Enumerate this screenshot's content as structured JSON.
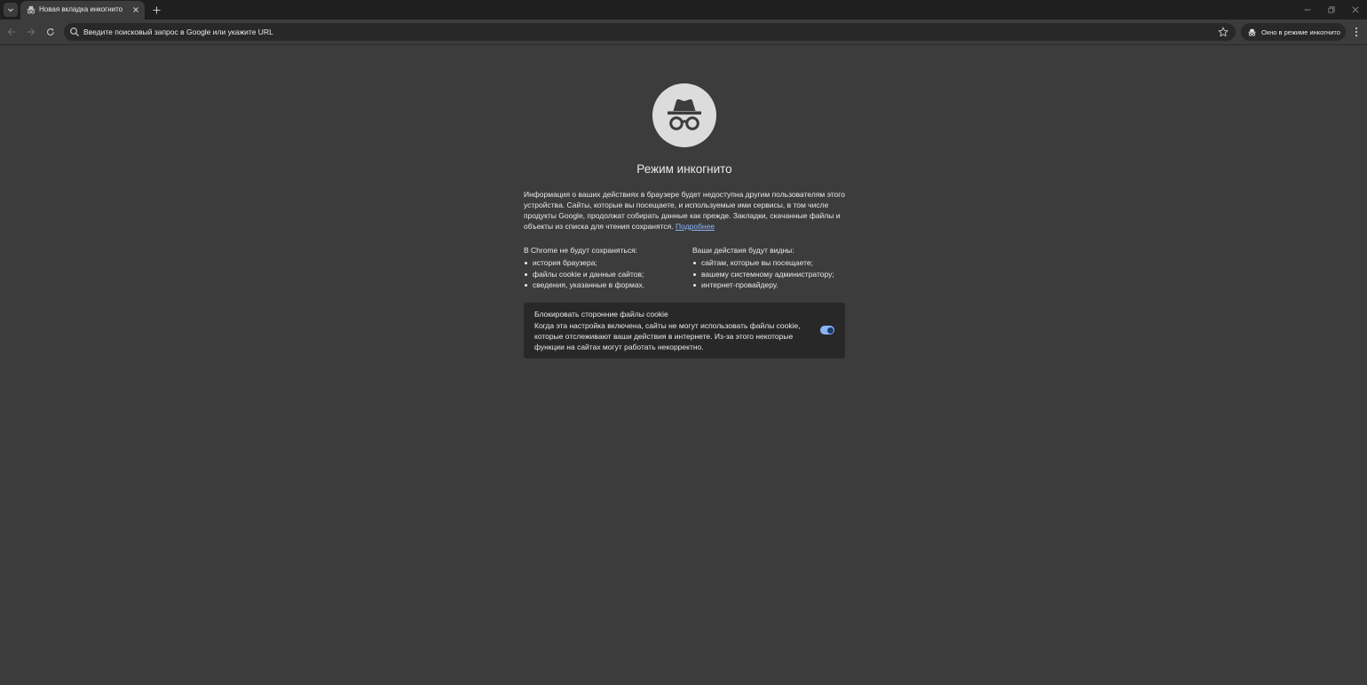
{
  "tab": {
    "title": "Новая вкладка инкогнито",
    "icon": "incognito-icon"
  },
  "toolbar": {
    "omnibox_placeholder": "Введите поисковый запрос в Google или укажите URL",
    "incognito_chip_label": "Окно в режиме инкогнито"
  },
  "page": {
    "title": "Режим инкогнито",
    "intro": "Информация о ваших действиях в браузере будет недоступна другим пользователям этого устройства. Сайты, которые вы посещаете, и используемые ими сервисы, в том числе продукты Google, продолжат собирать данные как прежде. Закладки, скачанные файлы и объекты из списка для чтения сохранятся.",
    "learn_more": "Подробнее",
    "not_saved": {
      "title": "В Chrome не будут сохраняться:",
      "items": [
        "история браузера;",
        "файлы cookie и данные сайтов;",
        "сведения, указанные в формах."
      ]
    },
    "visible_to": {
      "title": "Ваши действия будут видны:",
      "items": [
        "сайтам, которые вы посещаете;",
        "вашему системному администратору;",
        "интернет-провайдеру."
      ]
    },
    "cookie_card": {
      "title": "Блокировать сторонние файлы cookie",
      "description": "Когда эта настройка включена, сайты не могут использовать файлы cookie, которые отслеживают ваши действия в интернете. Из-за этого некоторые функции на сайтах могут работать некорректно.",
      "toggle_on": true
    }
  },
  "colors": {
    "background": "#3c3c3c",
    "frame": "#1f1f1f",
    "omnibox": "#282828",
    "accent": "#8ab4f8",
    "text": "#e8eaed"
  }
}
